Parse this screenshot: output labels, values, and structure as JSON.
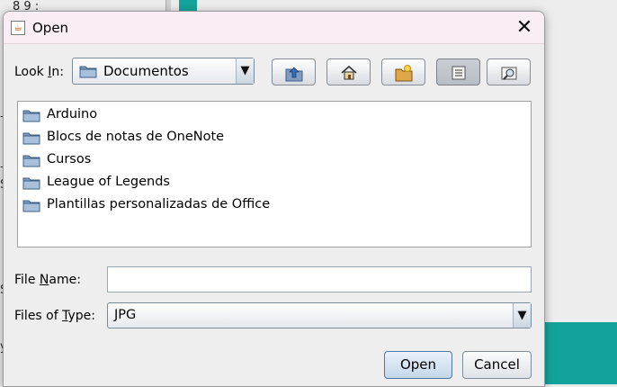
{
  "background": {
    "top_text": "8  9 :",
    "fragments": [
      {
        "text": "—"
      },
      {
        "text": "—"
      },
      {
        "text": "S"
      },
      {
        "text": "S"
      },
      {
        "text": "y"
      }
    ]
  },
  "dialog": {
    "title": "Open",
    "close_glyph": "✕",
    "title_icon": "java-cup-icon"
  },
  "look_in": {
    "label_prefix": "Look ",
    "label_mnemonic": "I",
    "label_suffix": "n:",
    "selected": "Documentos",
    "arrow": "▼"
  },
  "toolbar": {
    "buttons": [
      "up-one-level-icon",
      "home-icon",
      "new-folder-icon",
      "list-view-icon",
      "details-view-icon"
    ],
    "active": "list-view-icon"
  },
  "files": [
    {
      "name": "Arduino"
    },
    {
      "name": "Blocs de notas de OneNote"
    },
    {
      "name": "Cursos"
    },
    {
      "name": "League of Legends"
    },
    {
      "name": "Plantillas personalizadas de Office"
    }
  ],
  "file_name": {
    "label_prefix": "File ",
    "label_mnemonic": "N",
    "label_suffix": "ame:",
    "value": ""
  },
  "files_of_type": {
    "label_prefix": "Files of ",
    "label_mnemonic": "T",
    "label_suffix": "ype:",
    "selected": "JPG",
    "arrow": "▼"
  },
  "actions": {
    "open_label": "Open",
    "cancel_label": "Cancel"
  },
  "colors": {
    "accent_teal": "#14a39a",
    "titlebar": "#f8eef4"
  }
}
